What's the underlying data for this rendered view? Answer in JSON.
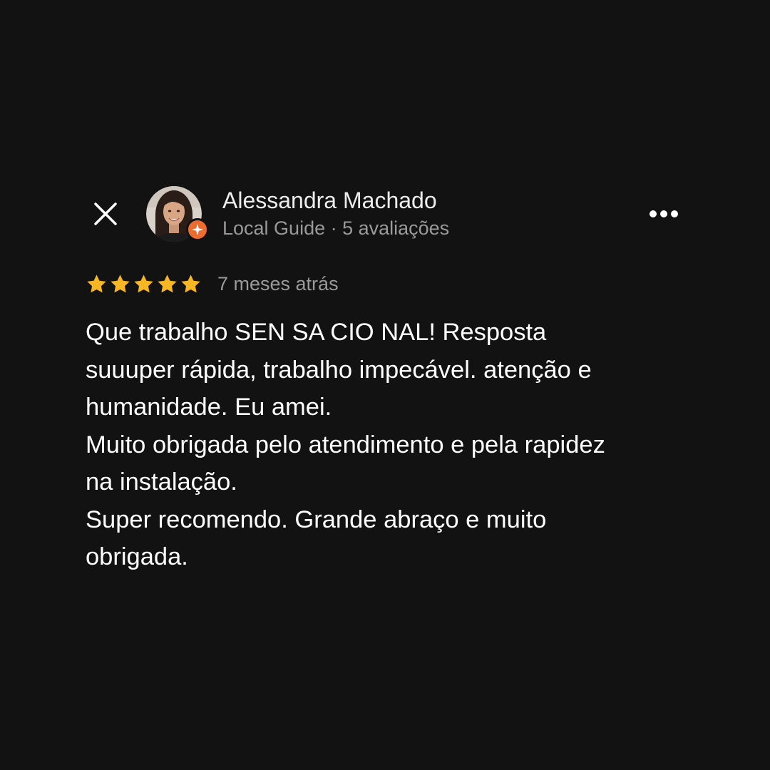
{
  "reviewer": {
    "name": "Alessandra Machado",
    "meta": "Local Guide · 5 avaliações",
    "avatar_icon": "avatar-photo",
    "badge_icon": "local-guide-star-icon",
    "badge_color": "#ed6c2f"
  },
  "toolbar": {
    "close_icon": "close-icon",
    "more_icon": "more-options-icon"
  },
  "rating": {
    "stars": 5,
    "max": 5,
    "star_color": "#f7b624",
    "time": "7 meses atrás"
  },
  "review": {
    "lines": [
      "Que trabalho SEN SA CIO NAL! Resposta",
      "suuuper rápida, trabalho impecável. atenção e",
      "humanidade. Eu amei.",
      "Muito obrigada pelo atendimento e pela rapidez",
      "na instalação.",
      "Super recomendo. Grande abraço e muito",
      "obrigada."
    ]
  },
  "colors": {
    "background": "#121212",
    "primary_text": "#ffffff",
    "secondary_text": "#9a9a9a"
  }
}
